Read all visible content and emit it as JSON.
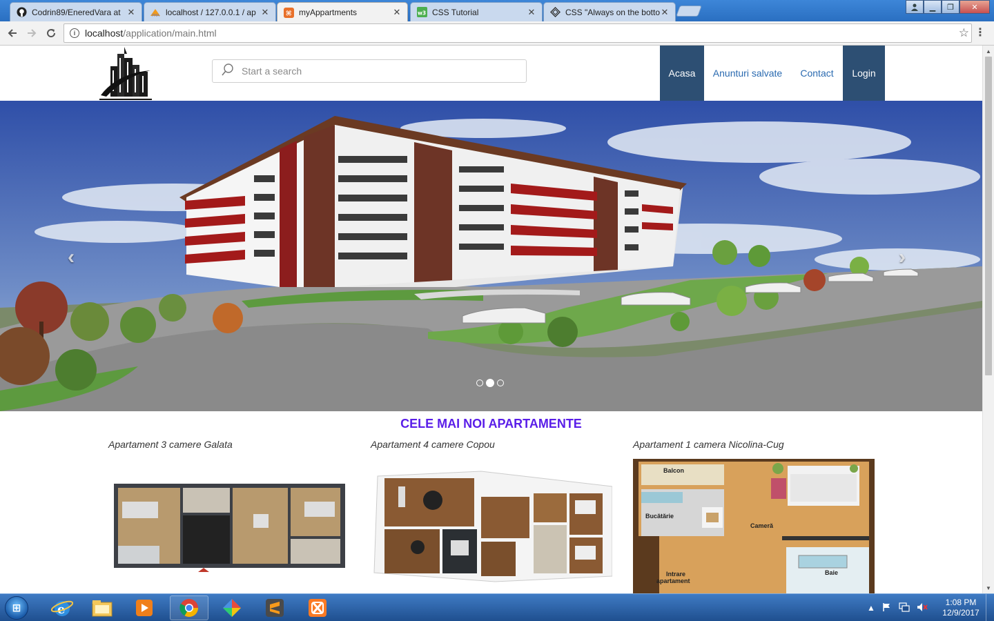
{
  "browser": {
    "tabs": [
      {
        "title": "Codrin89/EneredVara at",
        "icon": "github-icon",
        "active": false
      },
      {
        "title": "localhost / 127.0.0.1 / ap",
        "icon": "phpmyadmin-icon",
        "active": false
      },
      {
        "title": "myAppartments",
        "icon": "brackets-icon",
        "active": true
      },
      {
        "title": "CSS Tutorial",
        "icon": "w3schools-icon",
        "active": false
      },
      {
        "title": "CSS \"Always on the botto",
        "icon": "stackoverflow-icon",
        "active": false
      }
    ],
    "url_host": "localhost",
    "url_path": "/application/main.html"
  },
  "site": {
    "search_placeholder": "Start a search",
    "nav": [
      {
        "label": "Acasa",
        "highlighted": true
      },
      {
        "label": "Anunturi salvate",
        "highlighted": false
      },
      {
        "label": "Contact",
        "highlighted": false
      },
      {
        "label": "Login",
        "highlighted": true
      }
    ],
    "carousel": {
      "prev": "‹",
      "next": "›",
      "slides": 3,
      "active_slide": 2
    },
    "section_title": "CELE MAI NOI APARTAMENTE",
    "listings": [
      {
        "title": "Apartament 3 camere Galata"
      },
      {
        "title": "Apartament 4 camere Copou"
      },
      {
        "title": "Apartament 1 camera Nicolina-Cug",
        "plan_labels": {
          "balcon": "Balcon",
          "bucatarie": "Bucătărie",
          "camera": "Cameră",
          "intrare1": "Intrare",
          "intrare2": "apartament",
          "baie": "Baie"
        }
      }
    ]
  },
  "colors": {
    "nav_dark": "#2d4f73",
    "nav_link": "#2a6ab0",
    "section_title": "#5a1ee8"
  },
  "taskbar": {
    "apps": [
      "windows-start-icon",
      "internet-explorer-icon",
      "file-explorer-icon",
      "media-player-icon",
      "chrome-icon",
      "paint-app-icon",
      "sublime-text-icon",
      "xampp-icon"
    ],
    "time": "1:08 PM",
    "date": "12/9/2017"
  }
}
